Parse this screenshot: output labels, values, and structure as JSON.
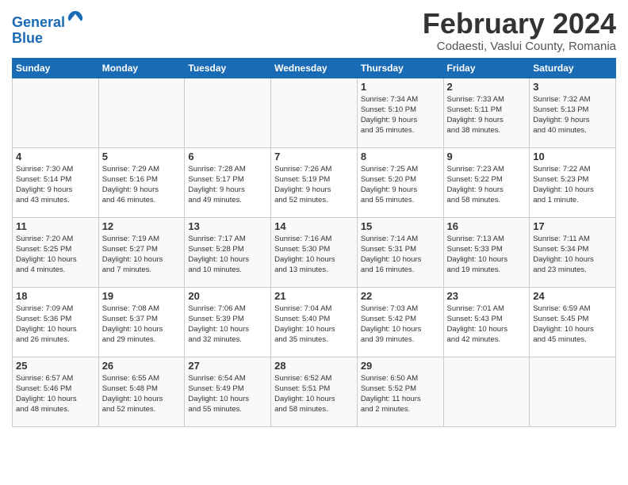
{
  "header": {
    "logo_line1": "General",
    "logo_line2": "Blue",
    "month_title": "February 2024",
    "subtitle": "Codaesti, Vaslui County, Romania"
  },
  "days_of_week": [
    "Sunday",
    "Monday",
    "Tuesday",
    "Wednesday",
    "Thursday",
    "Friday",
    "Saturday"
  ],
  "weeks": [
    [
      {
        "day": "",
        "info": ""
      },
      {
        "day": "",
        "info": ""
      },
      {
        "day": "",
        "info": ""
      },
      {
        "day": "",
        "info": ""
      },
      {
        "day": "1",
        "info": "Sunrise: 7:34 AM\nSunset: 5:10 PM\nDaylight: 9 hours\nand 35 minutes."
      },
      {
        "day": "2",
        "info": "Sunrise: 7:33 AM\nSunset: 5:11 PM\nDaylight: 9 hours\nand 38 minutes."
      },
      {
        "day": "3",
        "info": "Sunrise: 7:32 AM\nSunset: 5:13 PM\nDaylight: 9 hours\nand 40 minutes."
      }
    ],
    [
      {
        "day": "4",
        "info": "Sunrise: 7:30 AM\nSunset: 5:14 PM\nDaylight: 9 hours\nand 43 minutes."
      },
      {
        "day": "5",
        "info": "Sunrise: 7:29 AM\nSunset: 5:16 PM\nDaylight: 9 hours\nand 46 minutes."
      },
      {
        "day": "6",
        "info": "Sunrise: 7:28 AM\nSunset: 5:17 PM\nDaylight: 9 hours\nand 49 minutes."
      },
      {
        "day": "7",
        "info": "Sunrise: 7:26 AM\nSunset: 5:19 PM\nDaylight: 9 hours\nand 52 minutes."
      },
      {
        "day": "8",
        "info": "Sunrise: 7:25 AM\nSunset: 5:20 PM\nDaylight: 9 hours\nand 55 minutes."
      },
      {
        "day": "9",
        "info": "Sunrise: 7:23 AM\nSunset: 5:22 PM\nDaylight: 9 hours\nand 58 minutes."
      },
      {
        "day": "10",
        "info": "Sunrise: 7:22 AM\nSunset: 5:23 PM\nDaylight: 10 hours\nand 1 minute."
      }
    ],
    [
      {
        "day": "11",
        "info": "Sunrise: 7:20 AM\nSunset: 5:25 PM\nDaylight: 10 hours\nand 4 minutes."
      },
      {
        "day": "12",
        "info": "Sunrise: 7:19 AM\nSunset: 5:27 PM\nDaylight: 10 hours\nand 7 minutes."
      },
      {
        "day": "13",
        "info": "Sunrise: 7:17 AM\nSunset: 5:28 PM\nDaylight: 10 hours\nand 10 minutes."
      },
      {
        "day": "14",
        "info": "Sunrise: 7:16 AM\nSunset: 5:30 PM\nDaylight: 10 hours\nand 13 minutes."
      },
      {
        "day": "15",
        "info": "Sunrise: 7:14 AM\nSunset: 5:31 PM\nDaylight: 10 hours\nand 16 minutes."
      },
      {
        "day": "16",
        "info": "Sunrise: 7:13 AM\nSunset: 5:33 PM\nDaylight: 10 hours\nand 19 minutes."
      },
      {
        "day": "17",
        "info": "Sunrise: 7:11 AM\nSunset: 5:34 PM\nDaylight: 10 hours\nand 23 minutes."
      }
    ],
    [
      {
        "day": "18",
        "info": "Sunrise: 7:09 AM\nSunset: 5:36 PM\nDaylight: 10 hours\nand 26 minutes."
      },
      {
        "day": "19",
        "info": "Sunrise: 7:08 AM\nSunset: 5:37 PM\nDaylight: 10 hours\nand 29 minutes."
      },
      {
        "day": "20",
        "info": "Sunrise: 7:06 AM\nSunset: 5:39 PM\nDaylight: 10 hours\nand 32 minutes."
      },
      {
        "day": "21",
        "info": "Sunrise: 7:04 AM\nSunset: 5:40 PM\nDaylight: 10 hours\nand 35 minutes."
      },
      {
        "day": "22",
        "info": "Sunrise: 7:03 AM\nSunset: 5:42 PM\nDaylight: 10 hours\nand 39 minutes."
      },
      {
        "day": "23",
        "info": "Sunrise: 7:01 AM\nSunset: 5:43 PM\nDaylight: 10 hours\nand 42 minutes."
      },
      {
        "day": "24",
        "info": "Sunrise: 6:59 AM\nSunset: 5:45 PM\nDaylight: 10 hours\nand 45 minutes."
      }
    ],
    [
      {
        "day": "25",
        "info": "Sunrise: 6:57 AM\nSunset: 5:46 PM\nDaylight: 10 hours\nand 48 minutes."
      },
      {
        "day": "26",
        "info": "Sunrise: 6:55 AM\nSunset: 5:48 PM\nDaylight: 10 hours\nand 52 minutes."
      },
      {
        "day": "27",
        "info": "Sunrise: 6:54 AM\nSunset: 5:49 PM\nDaylight: 10 hours\nand 55 minutes."
      },
      {
        "day": "28",
        "info": "Sunrise: 6:52 AM\nSunset: 5:51 PM\nDaylight: 10 hours\nand 58 minutes."
      },
      {
        "day": "29",
        "info": "Sunrise: 6:50 AM\nSunset: 5:52 PM\nDaylight: 11 hours\nand 2 minutes."
      },
      {
        "day": "",
        "info": ""
      },
      {
        "day": "",
        "info": ""
      }
    ]
  ]
}
